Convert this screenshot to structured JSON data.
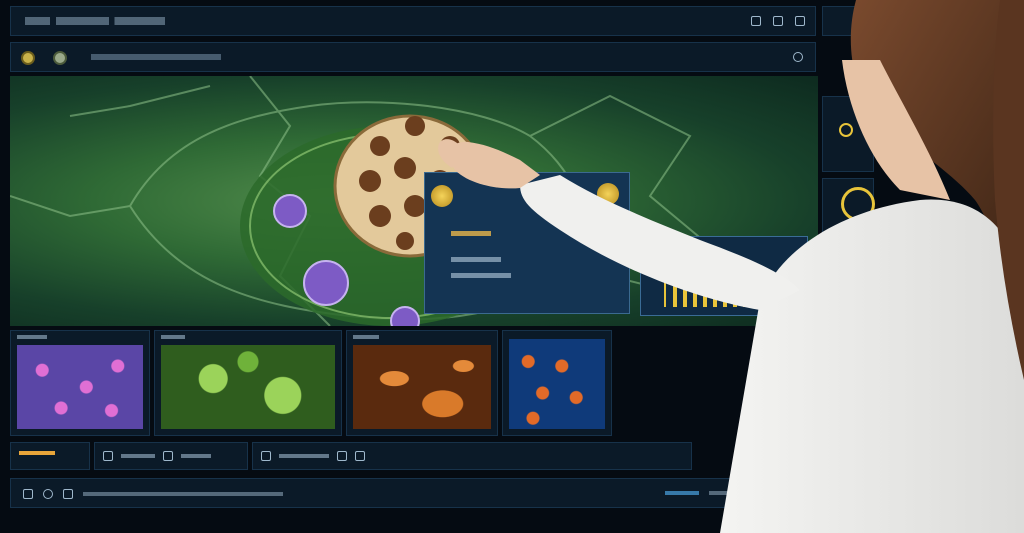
{
  "icons": {
    "top_right": [
      "grid-icon",
      "image-icon",
      "window-icon"
    ],
    "secondary": [
      "badge-icon",
      "badge-icon",
      "gear-icon"
    ]
  },
  "viewer": {
    "subject": "cell-microscopy",
    "colors": {
      "background": "#2f6a35",
      "nucleus": "#e3c99b",
      "vesicle": "#7d5bc5"
    }
  },
  "popup": {},
  "chart_card": {
    "bar_levels": [
      0.6,
      0.55,
      0.6,
      0.55,
      0.6,
      0.55,
      0.6,
      0.55,
      0.6,
      0.55,
      0.6,
      0.55
    ]
  },
  "thumbnails": [
    {
      "name": "thumb-purple-cells",
      "colors": [
        "#6a4fb0",
        "#e06fd4"
      ]
    },
    {
      "name": "thumb-green-tissue",
      "colors": [
        "#3f7f2a",
        "#9bd35a"
      ]
    },
    {
      "name": "thumb-orange-cells",
      "colors": [
        "#7a3a12",
        "#e48a3a"
      ]
    },
    {
      "name": "thumb-blue-orange-cells",
      "colors": [
        "#0f3a7a",
        "#e26a28"
      ]
    }
  ],
  "accent": "#e8c43a"
}
